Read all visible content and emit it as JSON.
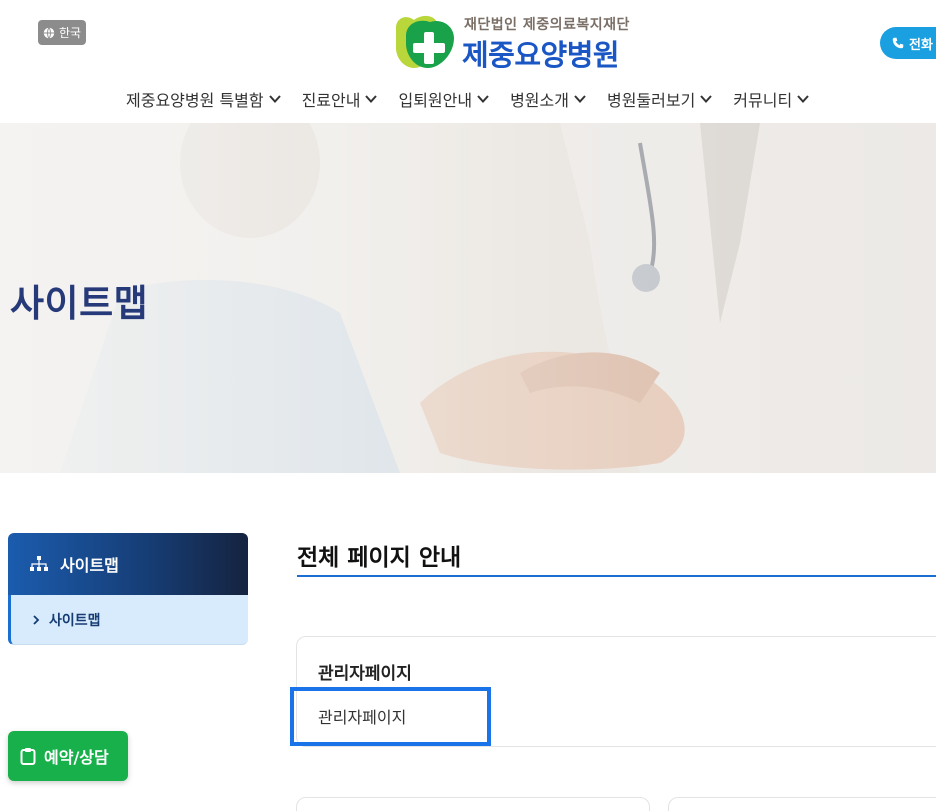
{
  "header": {
    "lang_label": "한국",
    "logo_subtitle": "재단법인 제중의료복지재단",
    "logo_title": "제중요양병원",
    "phone_label": "전화"
  },
  "nav": {
    "items": [
      {
        "label": "제중요양병원 특별함"
      },
      {
        "label": "진료안내"
      },
      {
        "label": "입퇴원안내"
      },
      {
        "label": "병원소개"
      },
      {
        "label": "병원둘러보기"
      },
      {
        "label": "커뮤니티"
      }
    ]
  },
  "hero": {
    "title": "사이트맵"
  },
  "sidebar": {
    "heading": "사이트맵",
    "items": [
      {
        "label": "사이트맵"
      }
    ]
  },
  "content": {
    "title": "전체 페이지 안내",
    "cards": [
      {
        "title": "관리자페이지",
        "links": [
          "관리자페이지"
        ]
      }
    ]
  },
  "floating": {
    "reserve_label": "예약/상담"
  },
  "colors": {
    "brand_blue": "#1a56c4",
    "accent_green": "#17b04a",
    "phone_blue": "#1a9fe0",
    "hero_title": "#263a7a",
    "highlight": "#1a73e8"
  }
}
